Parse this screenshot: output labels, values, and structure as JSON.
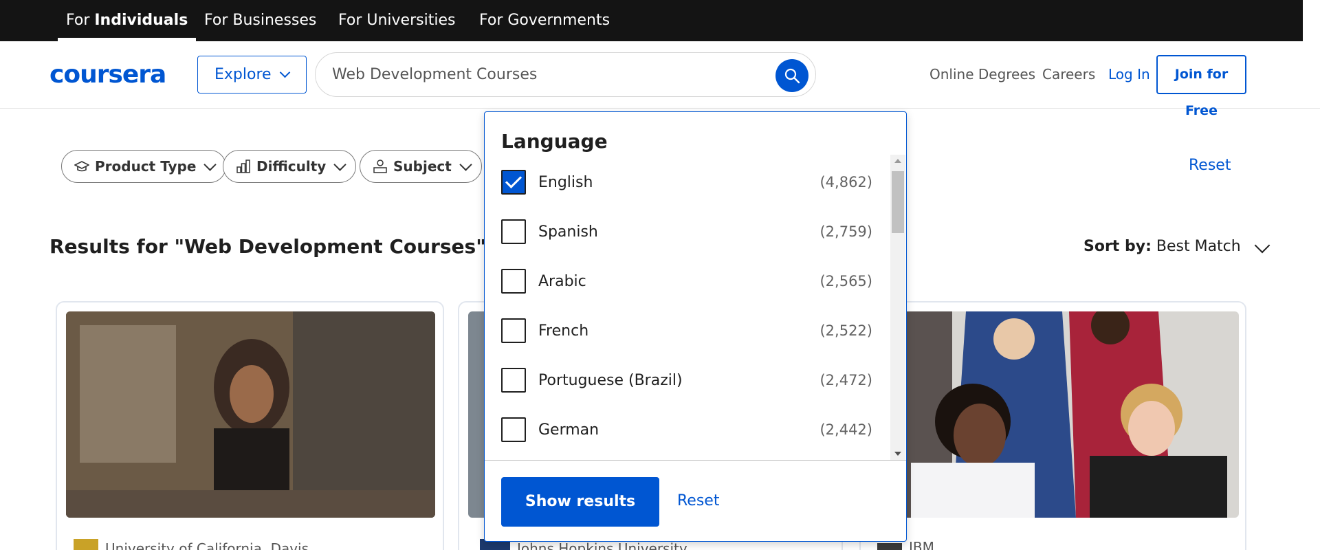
{
  "topnav": {
    "tabs": [
      {
        "prefix": "For ",
        "bold": "Individuals"
      },
      {
        "label": "For Businesses"
      },
      {
        "label": "For Universities"
      },
      {
        "label": "For Governments"
      }
    ]
  },
  "header": {
    "logo": "coursera",
    "explore_label": "Explore",
    "search_value": "Web Development Courses",
    "links": [
      "Online Degrees",
      "Careers",
      "Log In"
    ],
    "join_label": "Join for Free"
  },
  "filters": {
    "pills": [
      "Product Type",
      "Difficulty",
      "Subject"
    ],
    "reset_label": "Reset"
  },
  "results": {
    "title": "Results for \"Web Development Courses\"",
    "sort_prefix": "Sort by:",
    "sort_value": "Best Match"
  },
  "cards": [
    {
      "partner": "University of California, Davis"
    },
    {
      "partner": "Johns Hopkins University"
    },
    {
      "partner": "IBM"
    }
  ],
  "language_dropdown": {
    "title": "Language",
    "options": [
      {
        "label": "English",
        "count": "(4,862)",
        "checked": true
      },
      {
        "label": "Spanish",
        "count": "(2,759)",
        "checked": false
      },
      {
        "label": "Arabic",
        "count": "(2,565)",
        "checked": false
      },
      {
        "label": "French",
        "count": "(2,522)",
        "checked": false
      },
      {
        "label": "Portuguese (Brazil)",
        "count": "(2,472)",
        "checked": false
      },
      {
        "label": "German",
        "count": "(2,442)",
        "checked": false
      }
    ],
    "show_results_label": "Show results",
    "reset_label": "Reset"
  },
  "colors": {
    "brand": "#0056d2",
    "topbar": "#141414"
  }
}
